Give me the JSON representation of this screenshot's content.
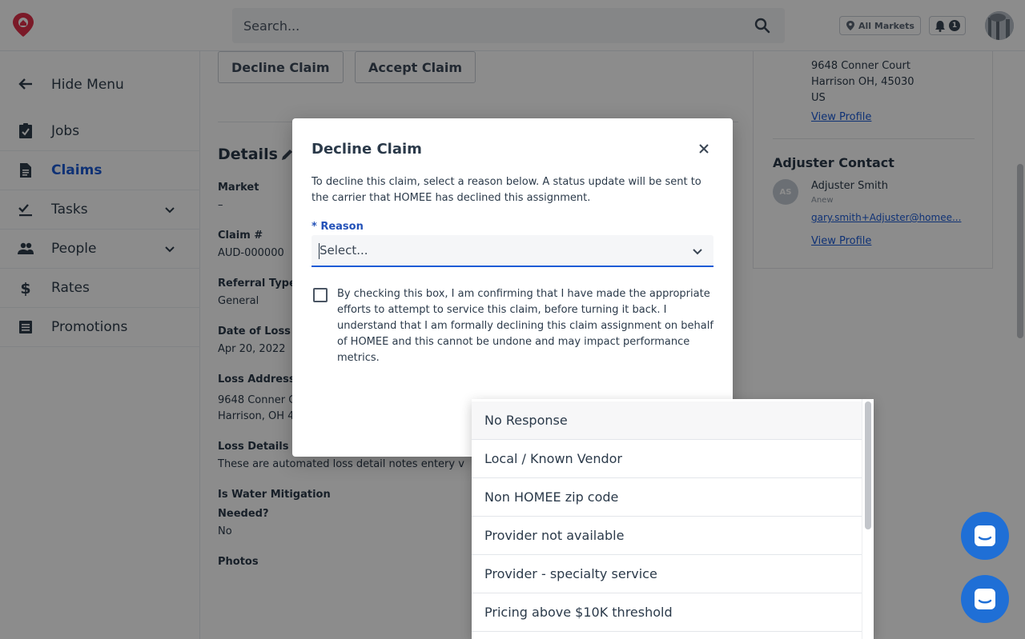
{
  "header": {
    "search_placeholder": "Search...",
    "market_label": "All Markets",
    "notification_count": "1"
  },
  "sidebar": {
    "items": [
      {
        "label": "Hide Menu",
        "icon": "arrow-left-icon"
      },
      {
        "label": "Jobs",
        "icon": "clipboard-check-icon"
      },
      {
        "label": "Claims",
        "icon": "document-icon"
      },
      {
        "label": "Tasks",
        "icon": "checklist-icon"
      },
      {
        "label": "People",
        "icon": "people-icon"
      },
      {
        "label": "Rates",
        "icon": "dollar-icon"
      },
      {
        "label": "Promotions",
        "icon": "newspaper-icon"
      }
    ]
  },
  "actions": {
    "decline_label": "Decline Claim",
    "accept_label": "Accept Claim"
  },
  "details": {
    "title": "Details",
    "fields": [
      {
        "label": "Market",
        "value": "–"
      },
      {
        "label": "Claim #",
        "value": "AUD-000000"
      },
      {
        "label": "Referral Type",
        "value": "General"
      },
      {
        "label": "Date of Loss",
        "value": "Apr 20, 2022"
      },
      {
        "label": "Loss Address",
        "value_line1": "9648 Conner C",
        "value_line2": "Harrison, OH 4"
      },
      {
        "label": "Loss Details",
        "value": "These are automated loss detail notes entery v"
      },
      {
        "label_line1": "Is Water Mitigation",
        "label_line2": "Needed?",
        "value": "No"
      },
      {
        "label": "Photos"
      }
    ]
  },
  "right_panel": {
    "address_line1": "9648 Conner Court",
    "address_line2": "Harrison OH, 45030",
    "address_line3": "US",
    "view_profile_1": "View Profile",
    "adjuster_title": "Adjuster Contact",
    "adjuster_initials": "AS",
    "adjuster_name": "Adjuster Smith",
    "adjuster_sub": "Anew",
    "adjuster_email": "gary.smith+Adjuster@homee...",
    "view_profile_2": "View Profile"
  },
  "modal": {
    "title": "Decline Claim",
    "description": "To decline this claim, select a reason below. A status update will be sent to the carrier that HOMEE has declined this assignment.",
    "reason_label": "* Reason",
    "reason_placeholder": "Select...",
    "confirm_text": "By checking this box, I am confirming that I have made the appropriate efforts to attempt to service this claim, before turning it back. I understand that I am formally declining this claim assignment on behalf of HOMEE and this cannot be undone and may impact performance metrics."
  },
  "dropdown": {
    "options": [
      "No Response",
      "Local / Known Vendor",
      "Non HOMEE zip code",
      "Provider not available",
      "Provider - specialty service",
      "Pricing above $10K threshold"
    ]
  },
  "colors": {
    "primary": "#1d5bd6",
    "chat": "#1f6fd6",
    "logo": "#e0314a"
  }
}
